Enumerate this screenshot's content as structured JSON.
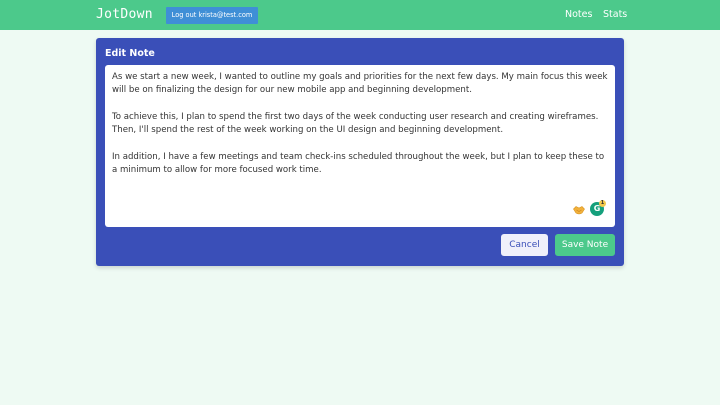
{
  "navbar": {
    "brand": "JotDown",
    "logout_label": "Log out krista@test.com",
    "links": [
      {
        "label": "Notes"
      },
      {
        "label": "Stats"
      }
    ],
    "color": "#4cc98b"
  },
  "editor": {
    "title": "Edit Note",
    "paragraphs": [
      "As we start a new week, I wanted to outline my goals and priorities for the next few days. My main focus this week will be on finalizing the design for our new mobile app and beginning development.",
      "To achieve this, I plan to spend the first two days of the week conducting user research and creating wireframes. Then, I'll spend the rest of the week working on the UI design and beginning development.",
      "In addition, I have a few meetings and team check-ins scheduled throughout the week, but I plan to keep these to a minimum to allow for more focused work time."
    ],
    "card_color": "#3a4fb8",
    "grammarly_icon": "G",
    "grammarly_badge": "1",
    "cancel_label": "Cancel",
    "save_label": "Save Note"
  }
}
